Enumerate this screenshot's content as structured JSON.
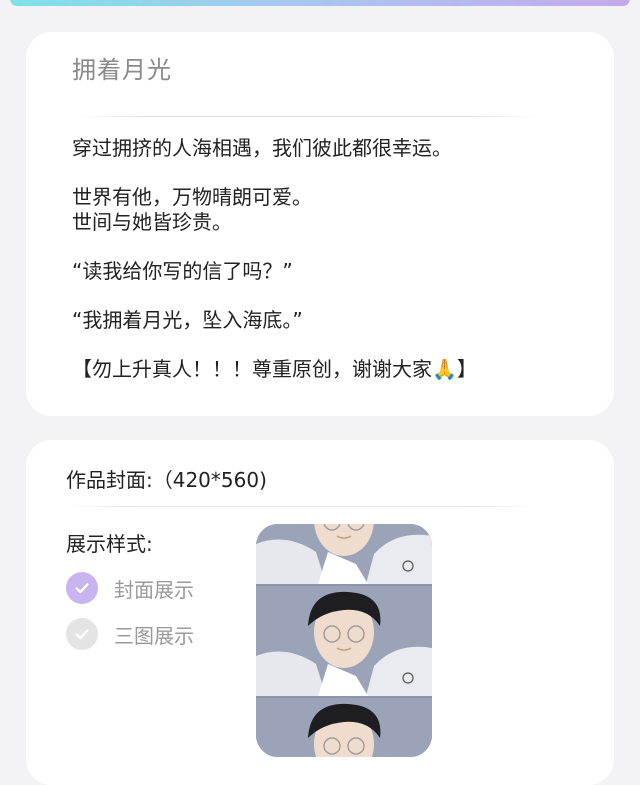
{
  "intro_card": {
    "title": "拥着月光",
    "description": {
      "line1": "穿过拥挤的人海相遇，我们彼此都很幸运。",
      "line2": "世界有他，万物晴朗可爱。",
      "line3": "世间与她皆珍贵。",
      "line4": "“读我给你写的信了吗？”",
      "line5": "“我拥着月光，坠入海底。”",
      "line6": "【勿上升真人！！！尊重原创，谢谢大家🙏】"
    }
  },
  "cover_card": {
    "cover_label": "作品封面:（420*560)",
    "style_label": "展示样式:",
    "options": [
      {
        "label": "封面展示",
        "selected": true,
        "icon": "check-icon"
      },
      {
        "label": "三图展示",
        "selected": false,
        "icon": "check-icon"
      }
    ]
  },
  "colors": {
    "accent_gradient_start": "#7fe0e6",
    "accent_gradient_end": "#c4a8ee",
    "selected_radio": "#c8b4ee",
    "unselected_radio": "#e4e4e4"
  }
}
